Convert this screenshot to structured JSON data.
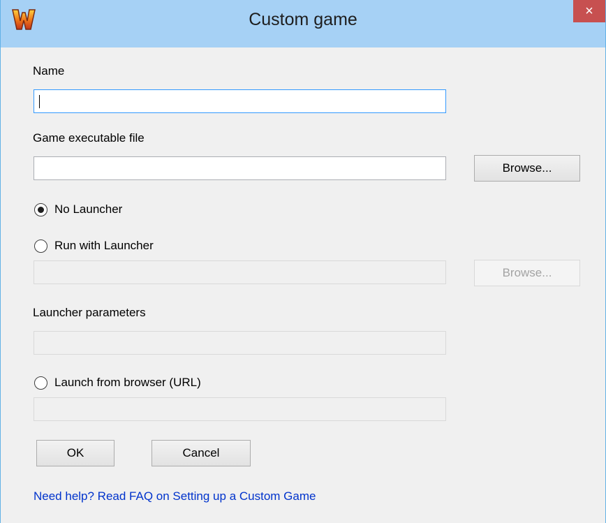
{
  "window": {
    "title": "Custom game",
    "close_glyph": "×",
    "logo_icon": "w-logo-icon"
  },
  "form": {
    "name_label": "Name",
    "name_value": "",
    "exe_label": "Game executable file",
    "exe_value": "",
    "browse_label": "Browse...",
    "no_launcher_label": "No Launcher",
    "run_with_launcher_label": "Run with Launcher",
    "launcher_path_value": "",
    "launcher_browse_label": "Browse...",
    "launcher_params_label": "Launcher parameters",
    "launcher_params_value": "",
    "browser_label": "Launch from browser (URL)",
    "browser_url_value": "",
    "selected_option": "No Launcher"
  },
  "actions": {
    "ok_label": "OK",
    "cancel_label": "Cancel"
  },
  "help": {
    "link_text": "Need help? Read FAQ on Setting up a Custom Game"
  },
  "colors": {
    "titlebar": "#a6d1f5",
    "close_button": "#c75050",
    "link": "#0033cc"
  }
}
